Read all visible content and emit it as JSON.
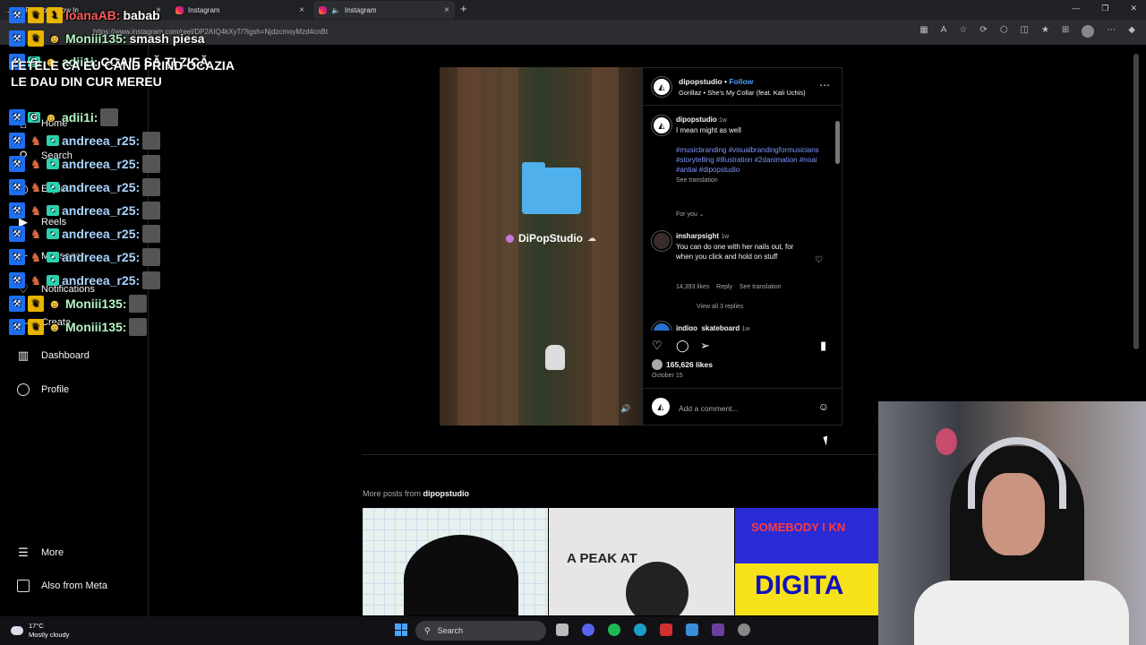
{
  "browser": {
    "tabs": [
      {
        "label": "...cret Fashion Show In"
      },
      {
        "label": "Instagram"
      },
      {
        "label": "Instagram"
      }
    ],
    "url": "https://www.instagram.com/reel/DP2AIQ4kXyT/?igsh=NjdzcmoyMzd4cnBt"
  },
  "sidebar": {
    "items": [
      {
        "label": "Home",
        "icon": "home-icon"
      },
      {
        "label": "Search",
        "icon": "search-icon"
      },
      {
        "label": "Explore",
        "icon": "explore-icon"
      },
      {
        "label": "Reels",
        "icon": "reels-icon"
      },
      {
        "label": "Messages",
        "icon": "messages-icon"
      },
      {
        "label": "Notifications",
        "icon": "heart-icon"
      },
      {
        "label": "Create",
        "icon": "plus-icon"
      },
      {
        "label": "Dashboard",
        "icon": "dashboard-icon"
      },
      {
        "label": "Profile",
        "icon": "profile-icon"
      }
    ],
    "more": "More",
    "also_from_meta": "Also from Meta"
  },
  "chat": {
    "lines": [
      {
        "user": "IoanaAB:",
        "msg": "babab"
      },
      {
        "user": "Moniii135:",
        "msg": "smash piesa"
      },
      {
        "user": "adii1i:",
        "msg": "COAIE SĂ ȚI ZICĂ"
      },
      {
        "user": "adii1i:",
        "msg": ""
      },
      {
        "user": "andreea_r25:",
        "msg": ""
      },
      {
        "user": "andreea_r25:",
        "msg": ""
      },
      {
        "user": "andreea_r25:",
        "msg": ""
      },
      {
        "user": "andreea_r25:",
        "msg": ""
      },
      {
        "user": "andreea_r25:",
        "msg": ""
      },
      {
        "user": "andreea_r25:",
        "msg": ""
      },
      {
        "user": "andreea_r25:",
        "msg": ""
      },
      {
        "user": "Moniii135:",
        "msg": ""
      },
      {
        "user": "Moniii135:",
        "msg": ""
      }
    ],
    "continuation": [
      "FETELE CA EU CÂND PRIND OCAZIA",
      "LE DAU DIN CUR MEREU"
    ]
  },
  "post": {
    "overlay_text": "DiPopStudio",
    "username": "dipopstudio",
    "follow": "Follow",
    "song": "Gorillaz • She's My Collar (feat. Kali Uchis)",
    "caption": {
      "user": "dipopstudio",
      "time": "1w",
      "text": "I mean might as well",
      "tags": "#musicbranding #visualbrandingformusicians #storytelling #illustration #2danimation #noai #antiai #dipopstudio",
      "see_translation": "See translation"
    },
    "for_you": "For you",
    "comment1": {
      "user": "insharpsight",
      "time": "1w",
      "text": "You can do one with her nails out, for when you click and hold on stuff",
      "likes": "14,393 likes",
      "reply": "Reply",
      "see_translation": "See translation",
      "view_replies": "View all 3 replies"
    },
    "comment2": {
      "user": "indigo_skateboard",
      "time": "1w"
    },
    "likes": "165,626 likes",
    "date": "October 15",
    "add_comment": "Add a comment..."
  },
  "more_posts": {
    "label": "More posts from",
    "user": "dipopstudio"
  },
  "thumbs": {
    "t2_text": "A PEAK AT",
    "t3_text1": "SOMEBODY I KN",
    "t3_text2": "DIGITA"
  },
  "taskbar": {
    "temp": "17°C",
    "weather": "Mostly cloudy",
    "search": "Search"
  },
  "colors": {
    "accent": "#4ba3ff",
    "tags": "#7e96ff",
    "background": "#000000"
  }
}
